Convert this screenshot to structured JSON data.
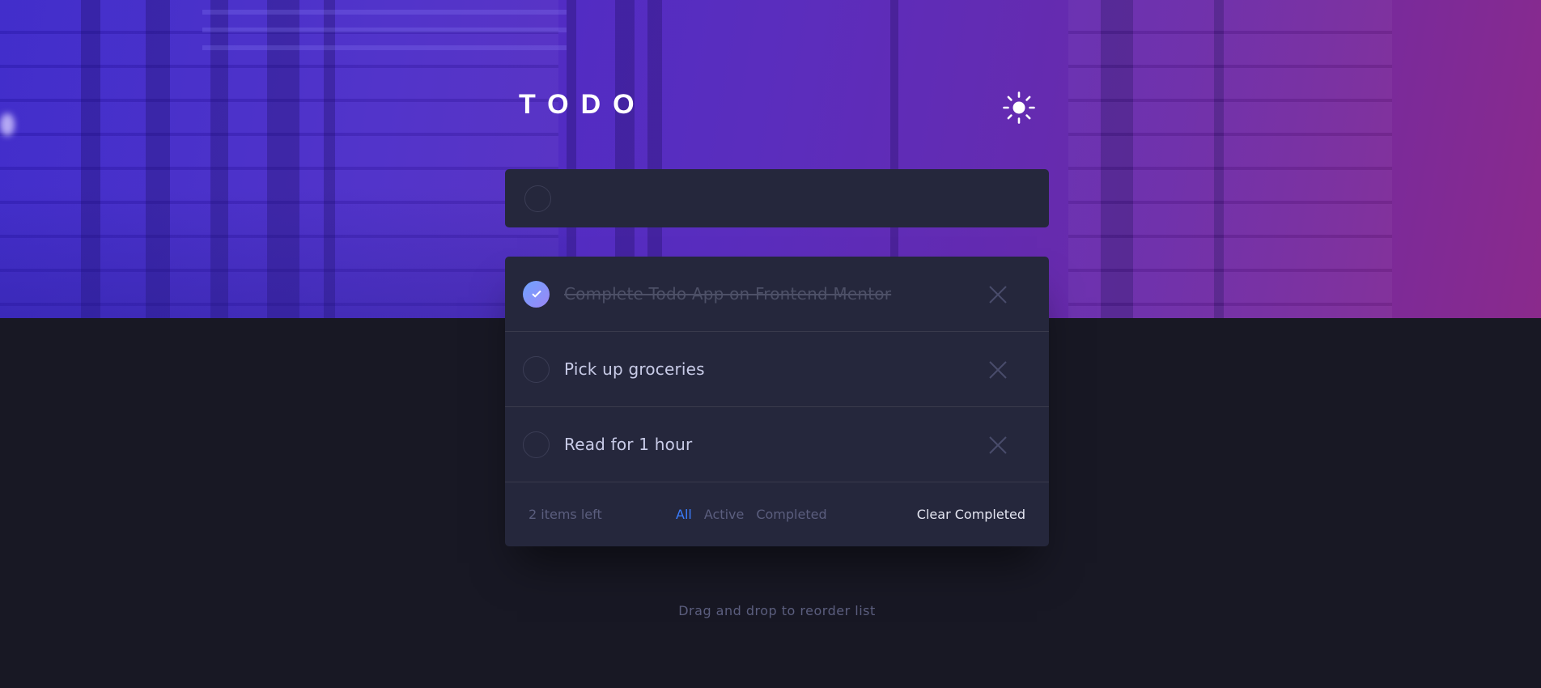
{
  "app": {
    "title": "TODO"
  },
  "new_todo": {
    "value": "",
    "placeholder": ""
  },
  "todos": [
    {
      "text": "Complete Todo App on Frontend Mentor",
      "completed": true
    },
    {
      "text": "Pick up groceries",
      "completed": false
    },
    {
      "text": "Read for 1 hour",
      "completed": false
    }
  ],
  "footer": {
    "items_left": "2 items left",
    "filters": {
      "all": "All",
      "active": "Active",
      "completed": "Completed"
    },
    "selected_filter": "All",
    "clear_label": "Clear Completed"
  },
  "hint": "Drag and drop to reorder list",
  "icons": {
    "theme_toggle": "sun-icon",
    "delete": "cross-icon",
    "check": "check-icon"
  },
  "colors": {
    "background": "#181824",
    "card": "#25273c",
    "accent": "#3a7cfd",
    "gradient_start": "#3a26c9",
    "gradient_end": "#8a2a8c"
  }
}
